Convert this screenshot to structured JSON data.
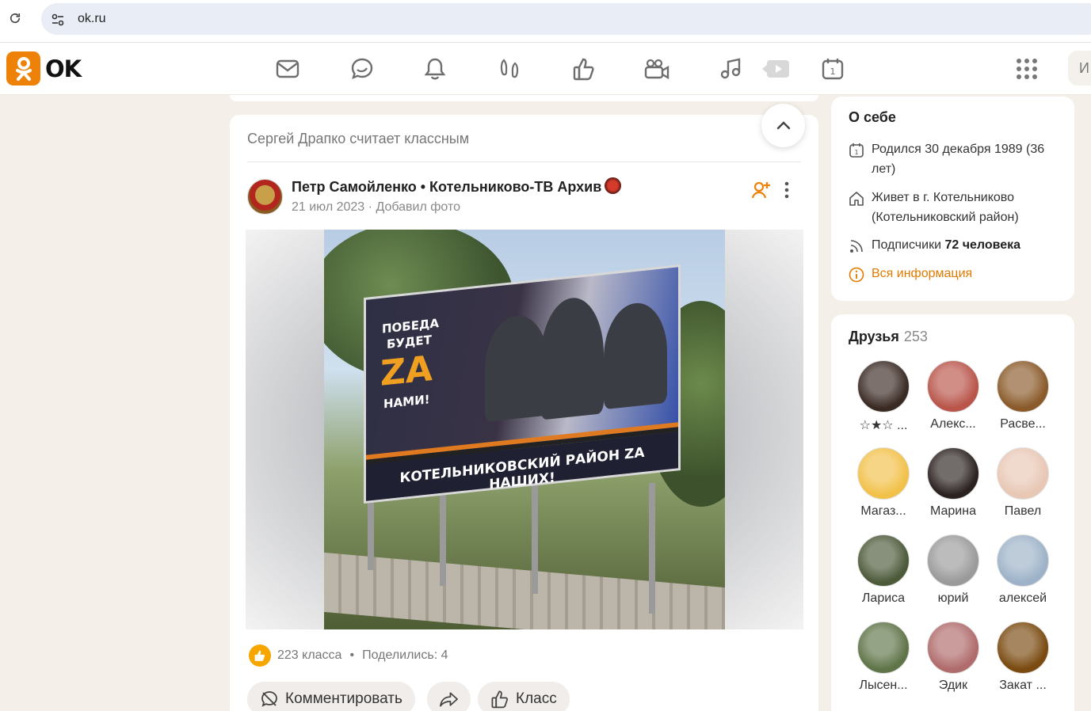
{
  "browser": {
    "url": "ok.ru"
  },
  "header": {
    "logo_text": "OK",
    "search_stub": "И",
    "nav": [
      "mail-icon",
      "chat-icon",
      "bell-icon",
      "guests-icon",
      "like-icon",
      "video-icon",
      "music-icon",
      "video-play-icon",
      "calendar-icon"
    ]
  },
  "post": {
    "activity": "Сергей Драпко считает классным",
    "author": "Петр Самойленко • Котельниково-ТВ Архив",
    "date": "21 июл 2023",
    "meta_sep": "·",
    "action": "Добавил фото",
    "photo": {
      "line1": "ПОБЕДА",
      "line2": "БУДЕТ",
      "za": "ZA",
      "line3": "НАМИ!",
      "bottom": "КОТЕЛЬНИКОВСКИЙ РАЙОН ZA НАШИХ!"
    },
    "likes_count": "223 класса",
    "bullet": "•",
    "shares": "Поделились: 4",
    "comment_label": "Комментировать",
    "like_label": "Класс"
  },
  "about": {
    "title": "О себе",
    "born": "Родился 30 декабря 1989 (36 лет)",
    "lives": "Живет в г. Котельниково (Котельниковский район)",
    "subscribers_label": "Подписчики",
    "subscribers_value": "72 человека",
    "all_info": "Вся информация"
  },
  "friends": {
    "title": "Друзья",
    "count": "253",
    "items": [
      {
        "name": "☆★☆ ...",
        "color": "#3a2a24"
      },
      {
        "name": "Алекс...",
        "color": "#b9554a"
      },
      {
        "name": "Расве...",
        "color": "#8a5a2a"
      },
      {
        "name": "Магаз...",
        "color": "#f2c14a"
      },
      {
        "name": "Марина",
        "color": "#2b2220"
      },
      {
        "name": "Павел",
        "color": "#e8c7b4"
      },
      {
        "name": "Лариса",
        "color": "#4d5a3a"
      },
      {
        "name": "юрий",
        "color": "#9a9a9a"
      },
      {
        "name": "алексей",
        "color": "#9db2c8"
      },
      {
        "name": "Лысен...",
        "color": "#5f7448"
      },
      {
        "name": "Эдик",
        "color": "#b06b6b"
      },
      {
        "name": "Закат ...",
        "color": "#7a4a10"
      }
    ]
  }
}
